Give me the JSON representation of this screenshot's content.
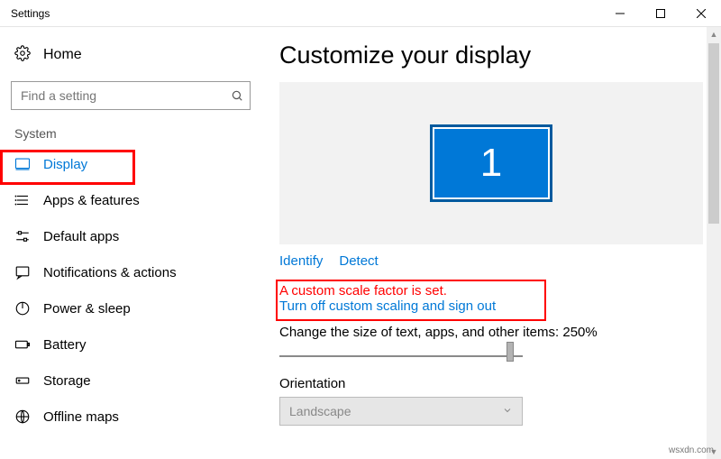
{
  "window": {
    "title": "Settings"
  },
  "sidebar": {
    "home": "Home",
    "search_placeholder": "Find a setting",
    "group": "System",
    "items": [
      {
        "label": "Display",
        "icon": "monitor-icon",
        "selected": true
      },
      {
        "label": "Apps & features",
        "icon": "list-icon"
      },
      {
        "label": "Default apps",
        "icon": "sliders-icon"
      },
      {
        "label": "Notifications & actions",
        "icon": "message-icon"
      },
      {
        "label": "Power & sleep",
        "icon": "power-icon"
      },
      {
        "label": "Battery",
        "icon": "battery-icon"
      },
      {
        "label": "Storage",
        "icon": "storage-icon"
      },
      {
        "label": "Offline maps",
        "icon": "map-icon"
      }
    ]
  },
  "content": {
    "heading": "Customize your display",
    "monitor_number": "1",
    "identify": "Identify",
    "detect": "Detect",
    "warning": "A custom scale factor is set.",
    "turn_off": "Turn off custom scaling and sign out",
    "scale_label": "Change the size of text, apps, and other items: 250%",
    "orientation_label": "Orientation",
    "orientation_value": "Landscape"
  },
  "watermark": "wsxdn.com"
}
